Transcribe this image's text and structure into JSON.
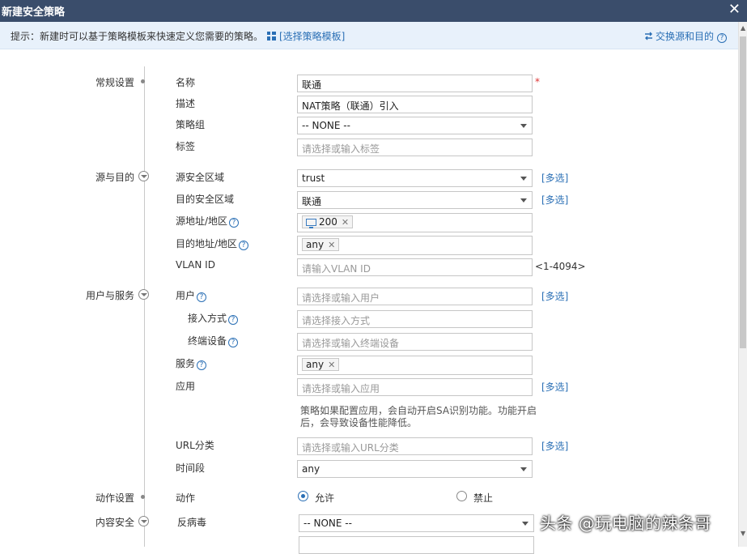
{
  "dialog": {
    "title": "新建安全策略",
    "close_symbol": "✕"
  },
  "hint": {
    "text": "提示：新建时可以基于策略模板来快速定义您需要的策略。",
    "template_link": "[选择策略模板]",
    "swap_link": "交换源和目的",
    "help_symbol": "?"
  },
  "sections": {
    "general": "常规设置",
    "src_dst": "源与目的",
    "user_service": "用户与服务",
    "action": "动作设置",
    "content_security": "内容安全"
  },
  "fields": {
    "name": {
      "label": "名称",
      "value": "联通",
      "required": "*"
    },
    "description": {
      "label": "描述",
      "value": "NAT策略（联通）引入"
    },
    "policy_group": {
      "label": "策略组",
      "value": "-- NONE --"
    },
    "tag": {
      "label": "标签",
      "placeholder": "请选择或输入标签"
    },
    "src_zone": {
      "label": "源安全区域",
      "value": "trust",
      "multi": "[多选]"
    },
    "dst_zone": {
      "label": "目的安全区域",
      "value": "联通",
      "multi": "[多选]"
    },
    "src_addr": {
      "label": "源地址/地区",
      "chip": "200"
    },
    "dst_addr": {
      "label": "目的地址/地区",
      "chip": "any"
    },
    "vlan": {
      "label": "VLAN ID",
      "placeholder": "请输入VLAN ID",
      "range": "<1-4094>"
    },
    "user": {
      "label": "用户",
      "placeholder": "请选择或输入用户",
      "multi": "[多选]"
    },
    "access_mode": {
      "label": "接入方式",
      "placeholder": "请选择接入方式"
    },
    "terminal": {
      "label": "终端设备",
      "placeholder": "请选择或输入终端设备"
    },
    "service": {
      "label": "服务",
      "chip": "any"
    },
    "application": {
      "label": "应用",
      "placeholder": "请选择或输入应用",
      "multi": "[多选]",
      "note": "策略如果配置应用，会自动开启SA识别功能。功能开启后，会导致设备性能降低。"
    },
    "url_category": {
      "label": "URL分类",
      "placeholder": "请选择或输入URL分类",
      "multi": "[多选]"
    },
    "time_range": {
      "label": "时间段",
      "value": "any"
    },
    "action": {
      "label": "动作",
      "allow": "允许",
      "deny": "禁止",
      "selected": "allow"
    },
    "antivirus": {
      "label": "反病毒",
      "value": "-- NONE --"
    }
  },
  "chip_remove_symbol": "✕",
  "watermark": "头条 @玩电脑的辣条哥"
}
